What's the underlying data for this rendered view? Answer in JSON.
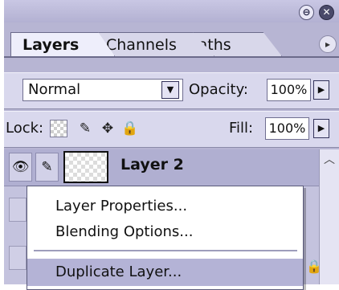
{
  "window": {
    "minimize_icon": "⊖",
    "close_icon": "✕"
  },
  "tabs": [
    {
      "label": "Layers",
      "active": true
    },
    {
      "label": "Channels",
      "active": false
    },
    {
      "label": "Paths",
      "active": false
    }
  ],
  "panel_menu_icon": "▸",
  "blend": {
    "mode": "Normal",
    "opacity_label": "Opacity:",
    "opacity_value": "100%"
  },
  "lock": {
    "label": "Lock:",
    "fill_label": "Fill:",
    "fill_value": "100%"
  },
  "layers": [
    {
      "name": "Layer 2",
      "visible": true,
      "selected": true
    }
  ],
  "context_menu": {
    "items": [
      {
        "label": "Layer Properties..."
      },
      {
        "label": "Blending Options..."
      },
      {
        "label": "Duplicate Layer...",
        "highlighted": true
      }
    ]
  }
}
